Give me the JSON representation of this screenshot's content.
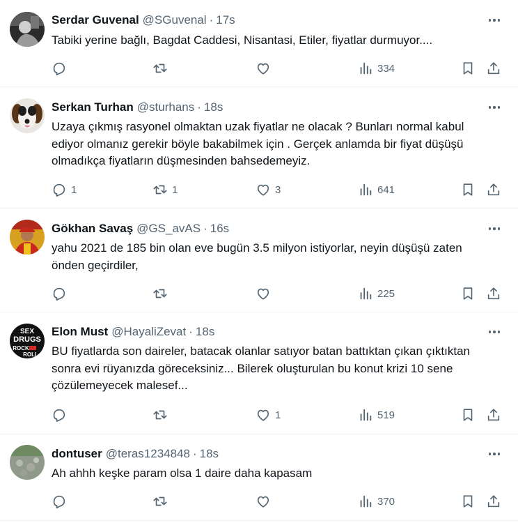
{
  "tweets": [
    {
      "name": "Serdar Guvenal",
      "handle": "@SGuvenal",
      "sep": "·",
      "time": "17s",
      "text": "Tabiki yerine bağlı, Bagdat Caddesi, Nisantasi, Etiler, fiyatlar durmuyor....",
      "replies": "",
      "retweets": "",
      "likes": "",
      "views": "334"
    },
    {
      "name": "Serkan Turhan",
      "handle": "@sturhans",
      "sep": "·",
      "time": "18s",
      "text": "Uzaya çıkmış rasyonel olmaktan uzak fiyatlar ne olacak ?  Bunları normal kabul ediyor olmanız gerekir böyle bakabilmek için . Gerçek anlamda bir fiyat düşüşü olmadıkça fiyatların düşmesinden bahsedemeyiz.",
      "replies": "1",
      "retweets": "1",
      "likes": "3",
      "views": "641"
    },
    {
      "name": "Gökhan Savaş",
      "handle": "@GS_avAS",
      "sep": "·",
      "time": "16s",
      "text": "yahu 2021 de 185 bin olan eve bugün 3.5 milyon istiyorlar, neyin düşüşü zaten önden  geçirdiler,",
      "replies": "",
      "retweets": "",
      "likes": "",
      "views": "225"
    },
    {
      "name": "Elon Must",
      "handle": "@HayaliZevat",
      "sep": "·",
      "time": "18s",
      "text": "BU fiyatlarda son daireler, batacak olanlar satıyor batan battıktan çıkan çıktıktan sonra evi rüyanızda göreceksiniz... Bilerek oluşturulan bu konut krizi 10 sene çözülemeyecek malesef...",
      "replies": "",
      "retweets": "",
      "likes": "1",
      "views": "519",
      "avatar_text": [
        "SEX",
        "DRUGS",
        "ROCK",
        "ROLL"
      ]
    },
    {
      "name": "dontuser",
      "handle": "@teras1234848",
      "sep": "·",
      "time": "18s",
      "text": "Ah ahhh keşke param olsa 1 daire daha kapasam",
      "replies": "",
      "retweets": "",
      "likes": "",
      "views": "370"
    }
  ],
  "colors": {
    "text": "#0f1419",
    "secondary": "#536471",
    "divider": "#eff3f4"
  },
  "icons": [
    "more-icon",
    "reply-icon",
    "retweet-icon",
    "like-icon",
    "views-icon",
    "bookmark-icon",
    "share-icon"
  ]
}
